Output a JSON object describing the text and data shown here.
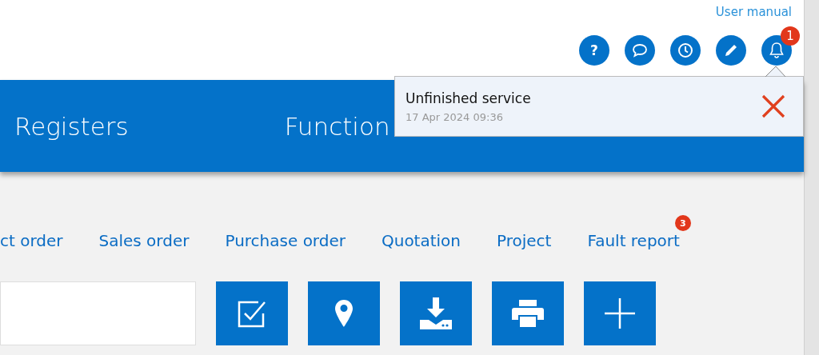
{
  "header": {
    "user_manual": "User manual",
    "icons": [
      {
        "kind": "help",
        "label": "?"
      },
      {
        "kind": "chat"
      },
      {
        "kind": "clock"
      },
      {
        "kind": "pencil"
      },
      {
        "kind": "bell",
        "badge": "1"
      }
    ]
  },
  "nav": [
    "Registers",
    "Function"
  ],
  "notification": {
    "title": "Unfinished service",
    "time": "17 Apr 2024 09:36"
  },
  "tabs": [
    {
      "label": "ct order"
    },
    {
      "label": "Sales order"
    },
    {
      "label": "Purchase order"
    },
    {
      "label": "Quotation"
    },
    {
      "label": "Project"
    },
    {
      "label": "Fault report",
      "badge": "3"
    }
  ],
  "toolbar": [
    {
      "kind": "checkbox"
    },
    {
      "kind": "pin"
    },
    {
      "kind": "download"
    },
    {
      "kind": "print"
    },
    {
      "kind": "add"
    }
  ]
}
